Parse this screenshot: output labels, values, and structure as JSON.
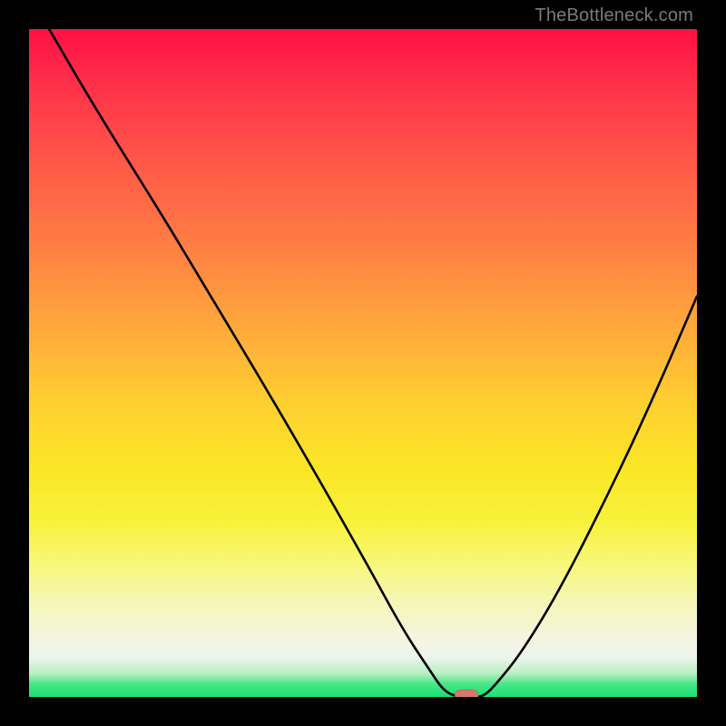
{
  "watermark": "TheBottleneck.com",
  "chart_data": {
    "type": "line",
    "title": "",
    "xlabel": "",
    "ylabel": "",
    "xlim": [
      0,
      100
    ],
    "ylim": [
      0,
      100
    ],
    "x": [
      3,
      10,
      20,
      26,
      38,
      50,
      56,
      60,
      62,
      64,
      66,
      68,
      70,
      74,
      80,
      88,
      94,
      100
    ],
    "y": [
      100,
      88,
      72,
      62,
      42,
      21,
      10,
      4,
      1,
      0,
      0,
      0,
      2,
      7,
      17,
      33,
      46,
      60
    ],
    "marker": {
      "x": 65.5,
      "y": 0
    },
    "gradient_bands": [
      {
        "pos": 0.0,
        "color": "#ff1044"
      },
      {
        "pos": 0.2,
        "color": "#ff5848"
      },
      {
        "pos": 0.44,
        "color": "#ffa63c"
      },
      {
        "pos": 0.66,
        "color": "#fbe626"
      },
      {
        "pos": 0.86,
        "color": "#f6f6b8"
      },
      {
        "pos": 0.98,
        "color": "#4be687"
      },
      {
        "pos": 1.0,
        "color": "#18e076"
      }
    ]
  }
}
